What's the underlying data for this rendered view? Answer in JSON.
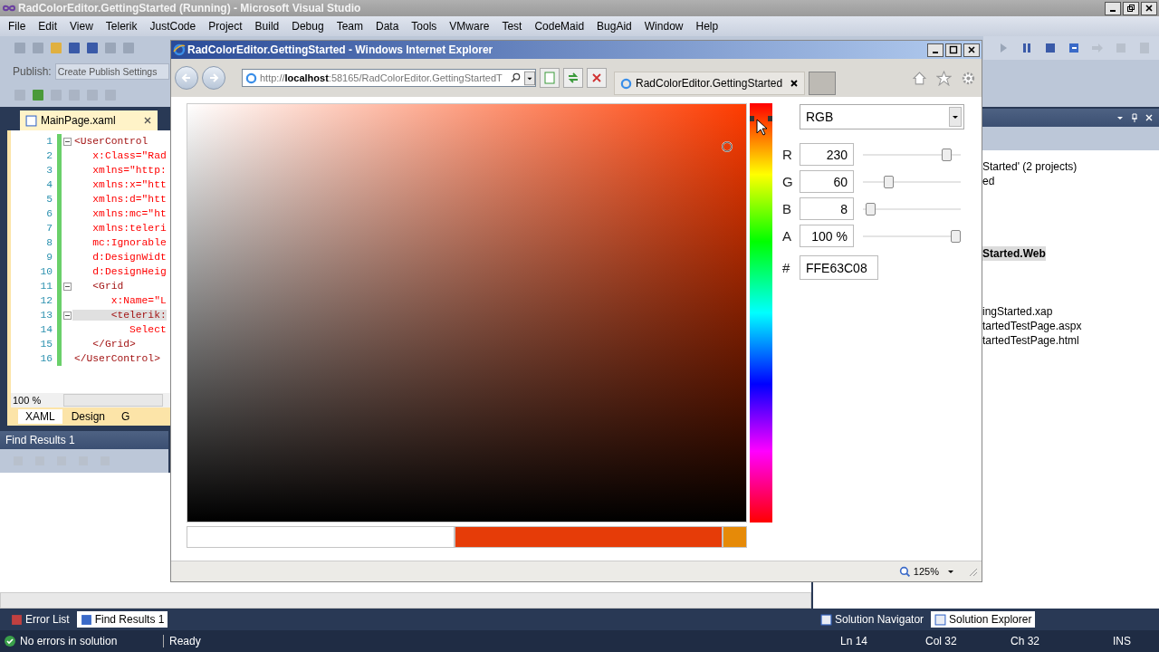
{
  "vs": {
    "title": "RadColorEditor.GettingStarted (Running) - Microsoft Visual Studio",
    "menu": [
      "File",
      "Edit",
      "View",
      "Telerik",
      "JustCode",
      "Project",
      "Build",
      "Debug",
      "Team",
      "Data",
      "Tools",
      "VMware",
      "Test",
      "CodeMaid",
      "BugAid",
      "Window",
      "Help"
    ],
    "publish": {
      "label": "Publish:",
      "placeholder": "Create Publish Settings"
    }
  },
  "document": {
    "tab": "MainPage.xaml",
    "lines": [
      {
        "number": "1",
        "text": "<UserControl",
        "kind": "tag",
        "fold": true,
        "highlighted": false
      },
      {
        "number": "2",
        "text": "   x:Class=\"Rad",
        "kind": "attribute",
        "fold": false,
        "highlighted": false
      },
      {
        "number": "3",
        "text": "   xmlns=\"http:",
        "kind": "attribute",
        "fold": false,
        "highlighted": false
      },
      {
        "number": "4",
        "text": "   xmlns:x=\"htt",
        "kind": "attribute",
        "fold": false,
        "highlighted": false
      },
      {
        "number": "5",
        "text": "   xmlns:d=\"htt",
        "kind": "attribute",
        "fold": false,
        "highlighted": false
      },
      {
        "number": "6",
        "text": "   xmlns:mc=\"ht",
        "kind": "attribute",
        "fold": false,
        "highlighted": false
      },
      {
        "number": "7",
        "text": "   xmlns:teleri",
        "kind": "attribute",
        "fold": false,
        "highlighted": false
      },
      {
        "number": "8",
        "text": "   mc:Ignorable",
        "kind": "attribute",
        "fold": false,
        "highlighted": false
      },
      {
        "number": "9",
        "text": "   d:DesignWidt",
        "kind": "attribute",
        "fold": false,
        "highlighted": false
      },
      {
        "number": "10",
        "text": "   d:DesignHeig",
        "kind": "attribute",
        "fold": false,
        "highlighted": false
      },
      {
        "number": "11",
        "text": "   <Grid",
        "kind": "tag",
        "fold": true,
        "highlighted": false
      },
      {
        "number": "12",
        "text": "      x:Name=\"L",
        "kind": "attribute",
        "fold": false,
        "highlighted": false
      },
      {
        "number": "13",
        "text": "      <telerik:",
        "kind": "tag",
        "fold": true,
        "highlighted": true
      },
      {
        "number": "14",
        "text": "         Select",
        "kind": "attribute",
        "fold": false,
        "highlighted": false
      },
      {
        "number": "15",
        "text": "   </Grid>",
        "kind": "tag",
        "fold": false,
        "highlighted": false
      },
      {
        "number": "16",
        "text": "</UserControl>",
        "kind": "tag",
        "fold": false,
        "highlighted": false
      }
    ],
    "zoom": "100 %",
    "view_tabs": [
      {
        "label": "XAML",
        "selected": true
      },
      {
        "label": "Design",
        "selected": false
      },
      {
        "label": "G",
        "selected": false
      }
    ]
  },
  "find_results": {
    "title": "Find Results 1"
  },
  "solution_explorer": {
    "items": [
      {
        "label": "Started' (2 projects)",
        "selected": false,
        "bold": false
      },
      {
        "label": "ed",
        "selected": false,
        "bold": false
      },
      {
        "label": "Started.Web",
        "selected": true,
        "bold": true
      },
      {
        "label": "ingStarted.xap",
        "selected": false,
        "bold": false
      },
      {
        "label": "tartedTestPage.aspx",
        "selected": false,
        "bold": false
      },
      {
        "label": "tartedTestPage.html",
        "selected": false,
        "bold": false
      }
    ]
  },
  "bottom_tabs_left": [
    {
      "label": "Error List",
      "selected": false
    },
    {
      "label": "Find Results 1",
      "selected": true
    }
  ],
  "bottom_tabs_right": [
    {
      "label": "Solution Navigator",
      "selected": false
    },
    {
      "label": "Solution Explorer",
      "selected": true
    }
  ],
  "status_bar": {
    "message": "No errors in solution",
    "state": "Ready",
    "line": "Ln 14",
    "column": "Col 32",
    "char": "Ch 32",
    "mode": "INS"
  },
  "browser": {
    "title": "RadColorEditor.GettingStarted - Windows Internet Explorer",
    "address": "http://**localhost**:58165/RadColorEditor.GettingStartedT",
    "tab": "RadColorEditor.GettingStarted",
    "zoom": "125%",
    "color_editor": {
      "mode": "RGB",
      "hex_label": "#",
      "channels": [
        {
          "name": "R",
          "value": "230",
          "level": 0.9
        },
        {
          "name": "G",
          "value": "60",
          "level": 0.24
        },
        {
          "name": "B",
          "value": "8",
          "level": 0.03
        },
        {
          "name": "A",
          "value": "100 %",
          "level": 1
        }
      ],
      "hex": "FFE63C08",
      "preview": [
        {
          "color": "#ffffff"
        },
        {
          "color": "#e63c08"
        },
        {
          "color": "#e68a08"
        }
      ]
    }
  }
}
